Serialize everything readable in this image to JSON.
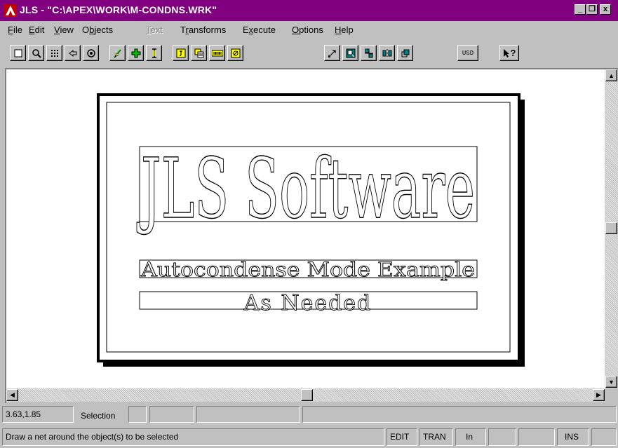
{
  "window": {
    "title": "JLS - \"C:\\APEX\\WORK\\M-CONDNS.WRK\"",
    "controls": [
      "_",
      "❐",
      "x"
    ]
  },
  "menu": [
    {
      "label": "File",
      "disabled": false
    },
    {
      "label": "Edit",
      "disabled": false
    },
    {
      "label": "View",
      "disabled": false
    },
    {
      "label": "Objects",
      "disabled": false
    },
    {
      "label": "Text",
      "disabled": true
    },
    {
      "label": "Transforms",
      "disabled": false
    },
    {
      "label": "Execute",
      "disabled": false
    },
    {
      "label": "Options",
      "disabled": false
    },
    {
      "label": "Help",
      "disabled": false
    }
  ],
  "toolbar": {
    "buttons": [
      {
        "icon": "new-page-icon"
      },
      {
        "icon": "zoom-icon"
      },
      {
        "icon": "grid-icon"
      },
      {
        "icon": "back-arrow-icon"
      },
      {
        "icon": "view-icon"
      },
      {
        "icon": "pencil-icon"
      },
      {
        "icon": "add-icon"
      },
      {
        "icon": "text-cursor-icon"
      },
      {
        "icon": "text-object-icon"
      },
      {
        "icon": "layers-icon"
      },
      {
        "icon": "barcode-icon"
      },
      {
        "icon": "image-icon"
      },
      {
        "icon": "move-arrow-icon"
      },
      {
        "icon": "resize-icon"
      },
      {
        "icon": "align-icon"
      },
      {
        "icon": "distribute-icon"
      },
      {
        "icon": "transform-icon"
      }
    ],
    "usd_label": "USD",
    "help_label": "?"
  },
  "document": {
    "title_text": "JLS Software",
    "line1_text": "Autocondense Mode Example",
    "line2_text": "As Needed"
  },
  "status": {
    "coords": "3.63,1.85",
    "mode": "Selection",
    "hint": "Draw a net around the object(s) to be selected",
    "edit": "EDIT",
    "tran": "TRAN",
    "units": "In",
    "ins": "INS"
  },
  "colors": {
    "titlebar": "#800080",
    "face": "#c0c0c0",
    "toolbar_icon_accent": "#ffff00",
    "toolbar_icon_green": "#008000",
    "toolbar_icon_blue": "#008080"
  }
}
